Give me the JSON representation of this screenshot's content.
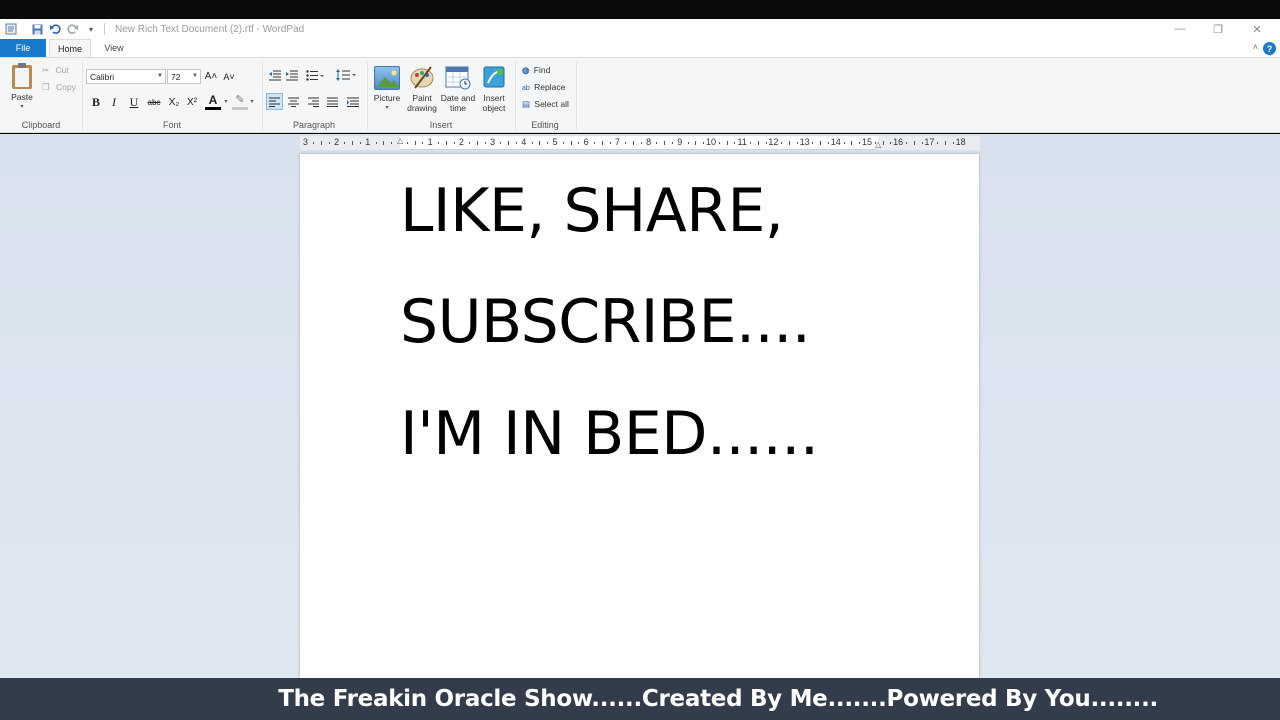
{
  "window": {
    "title": "New Rich Text Document (2).rtf - WordPad",
    "minimize_glyph": "—",
    "restore_glyph": "❐",
    "close_glyph": "✕"
  },
  "menu": {
    "file_label": "File",
    "home_label": "Home",
    "view_label": "View",
    "help_glyph": "?",
    "collapse_glyph": "˄"
  },
  "ribbon": {
    "clipboard": {
      "label": "Clipboard",
      "paste_label": "Paste",
      "cut_label": "Cut",
      "copy_label": "Copy"
    },
    "font": {
      "label": "Font",
      "family_value": "Calibri",
      "size_value": "72",
      "bold": "B",
      "italic": "I",
      "underline": "U",
      "strikethrough": "abc",
      "subscript": "X₂",
      "superscript": "X²",
      "grow": "A˄",
      "shrink": "A˅",
      "text_color": "A",
      "highlight": "✎"
    },
    "paragraph": {
      "label": "Paragraph"
    },
    "insert": {
      "label": "Insert",
      "picture_label": "Picture",
      "paint_label_1": "Paint",
      "paint_label_2": "drawing",
      "datetime_label_1": "Date and",
      "datetime_label_2": "time",
      "object_label_1": "Insert",
      "object_label_2": "object"
    },
    "editing": {
      "label": "Editing",
      "find_label": "Find",
      "replace_label": "Replace",
      "select_all_label": "Select all"
    }
  },
  "ruler": {
    "labels": [
      "3",
      "2",
      "1",
      "1",
      "2",
      "3",
      "4",
      "5",
      "6",
      "7",
      "8",
      "9",
      "10",
      "11",
      "12",
      "13",
      "14",
      "15",
      "16",
      "17",
      "18"
    ]
  },
  "document": {
    "lines": [
      "LIKE, SHARE,",
      "SUBSCRIBE....",
      "I'M IN BED......"
    ]
  },
  "banner": {
    "text": "The Freakin Oracle Show......Created By Me.......Powered By You........"
  },
  "colors": {
    "file_tab": "#1979ca",
    "ribbon_bg": "#f5f6f7",
    "workspace_bg": "#dbe4ef",
    "banner_bg": "#323c4a"
  }
}
